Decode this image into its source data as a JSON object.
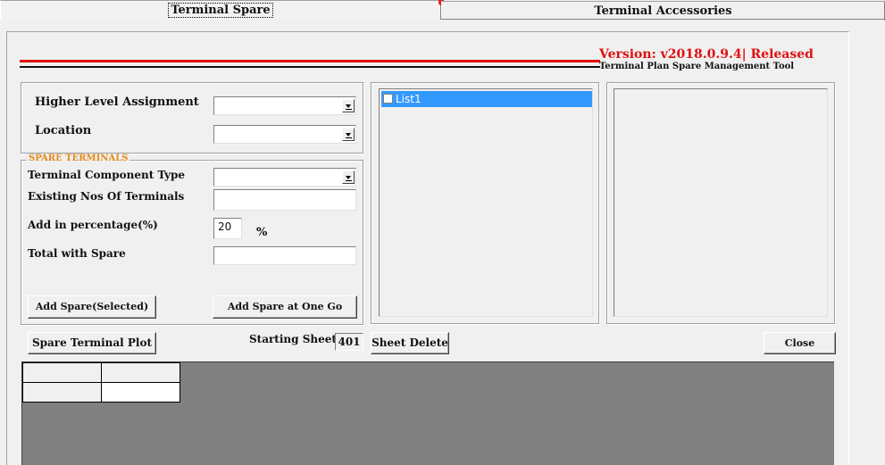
{
  "tabs": [
    {
      "label": "Terminal Spare",
      "active": true
    },
    {
      "label": "Terminal Accessories",
      "active": false
    }
  ],
  "header": {
    "version": "Version: v2018.0.9.4| Released",
    "tool_title": "Terminal Plan Spare Management Tool"
  },
  "assignment": {
    "higher_level_label": "Higher Level Assignment",
    "higher_level_value": "",
    "location_label": "Location",
    "location_value": ""
  },
  "spare_terminals": {
    "caption": "SPARE TERMINALS",
    "component_type_label": "Terminal Component Type",
    "component_type_value": "",
    "existing_label": "Existing Nos Of Terminals",
    "existing_value": "",
    "percent_label": "Add in percentage(%)",
    "percent_value": "20",
    "percent_unit": "%",
    "total_label": "Total with Spare",
    "total_value": "",
    "add_selected_label": "Add Spare(Selected)",
    "add_all_label": "Add Spare at One Go"
  },
  "list": {
    "items": [
      {
        "label": "List1",
        "checked": false,
        "selected": true
      }
    ]
  },
  "bottom": {
    "plot_label": "Spare Terminal Plot",
    "starting_sheet_label": "Starting Sheet",
    "starting_sheet_value": "401",
    "sheet_delete_label": "Sheet Delete",
    "close_label": "Close"
  },
  "colors": {
    "accent_red": "#e01010",
    "caption_orange": "#e88a1a",
    "selection_blue": "#3399ff",
    "grid_bg": "#808080"
  }
}
